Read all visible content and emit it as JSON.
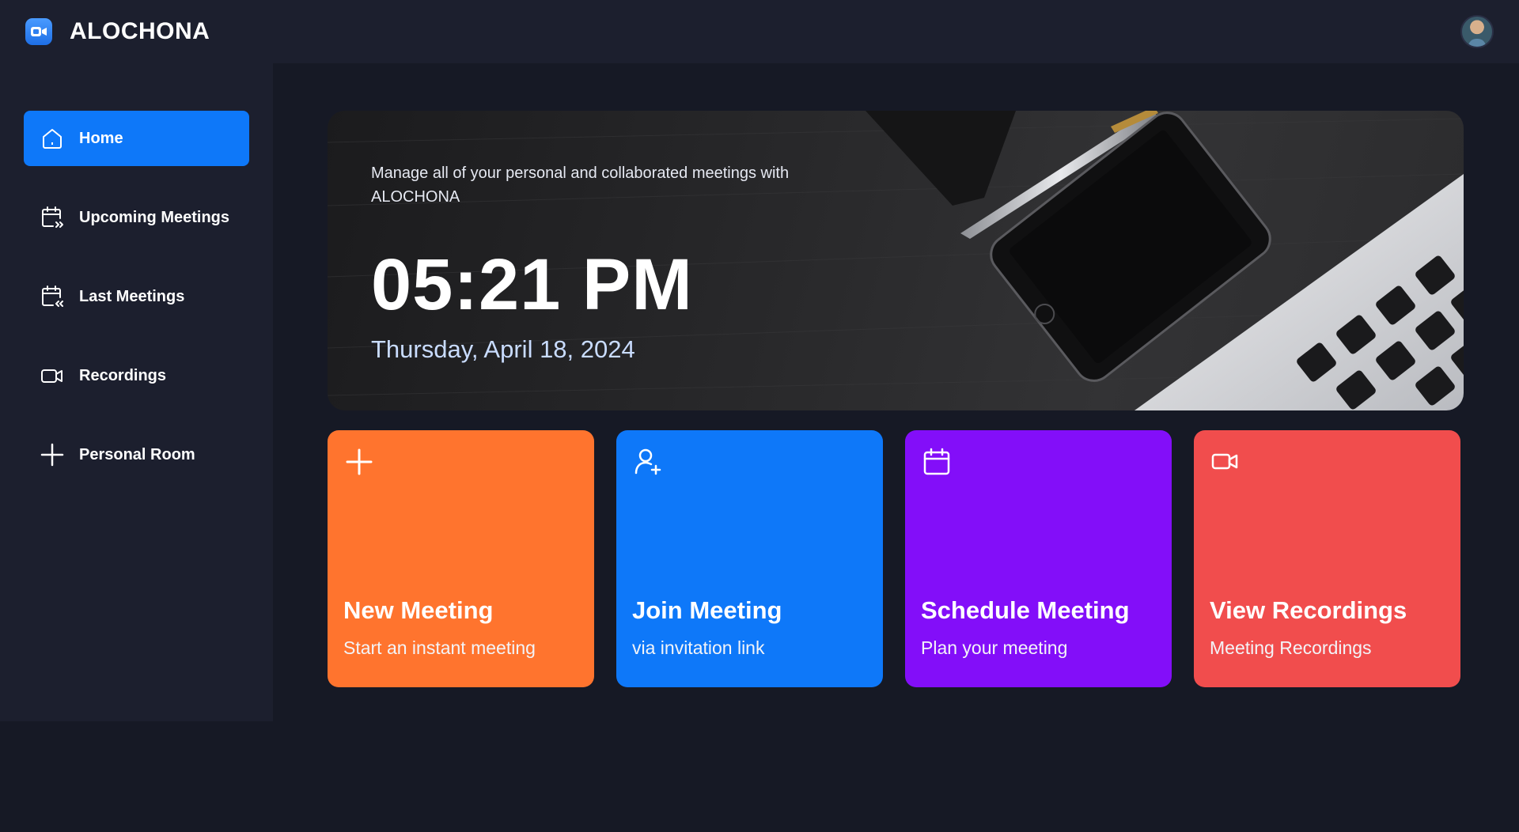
{
  "app": {
    "name": "ALOCHONA"
  },
  "sidebar": {
    "items": [
      {
        "label": "Home",
        "icon": "home-icon",
        "active": true
      },
      {
        "label": "Upcoming Meetings",
        "icon": "calendar-forward-icon",
        "active": false
      },
      {
        "label": "Last Meetings",
        "icon": "calendar-back-icon",
        "active": false
      },
      {
        "label": "Recordings",
        "icon": "video-icon",
        "active": false
      },
      {
        "label": "Personal Room",
        "icon": "plus-icon",
        "active": false
      }
    ]
  },
  "hero": {
    "subtitle": "Manage all of your personal and collaborated meetings with ALOCHONA",
    "time": "05:21 PM",
    "date": "Thursday, April 18, 2024"
  },
  "cards": [
    {
      "title": "New Meeting",
      "desc": "Start an instant meeting",
      "icon": "plus-icon",
      "color": "#ff742e"
    },
    {
      "title": "Join Meeting",
      "desc": "via invitation link",
      "icon": "user-add-icon",
      "color": "#0e78f9"
    },
    {
      "title": "Schedule Meeting",
      "desc": "Plan your meeting",
      "icon": "calendar-icon",
      "color": "#830ef9"
    },
    {
      "title": "View Recordings",
      "desc": "Meeting Recordings",
      "icon": "video-icon",
      "color": "#f14d4d"
    }
  ],
  "colors": {
    "background": "#161925",
    "surface": "#1c1f2e",
    "accent": "#0e78f9"
  }
}
